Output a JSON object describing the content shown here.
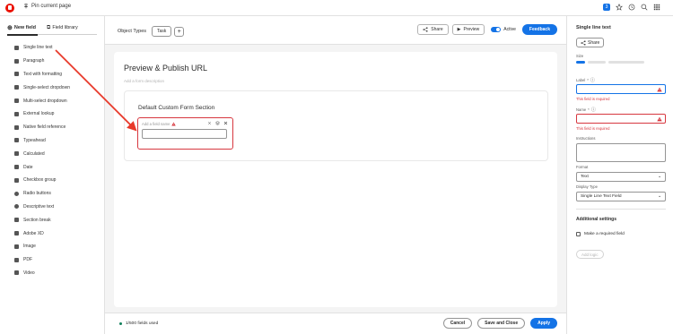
{
  "topbar": {
    "pin_label": "Pin current page",
    "badge_count": "3",
    "icons": [
      "star-icon",
      "history-icon",
      "search-icon",
      "apps-grid-icon"
    ]
  },
  "sidebar": {
    "tabs": [
      {
        "label": "New field",
        "icon": "plus-icon",
        "active": true
      },
      {
        "label": "Field library",
        "icon": "library-icon",
        "active": false
      }
    ],
    "items": [
      {
        "label": "Single line text",
        "icon": "text-icon"
      },
      {
        "label": "Paragraph",
        "icon": "paragraph-icon"
      },
      {
        "label": "Text with formatting",
        "icon": "format-icon"
      },
      {
        "label": "Single-select dropdown",
        "icon": "dropdown-icon"
      },
      {
        "label": "Multi-select dropdown",
        "icon": "multi-dropdown-icon"
      },
      {
        "label": "External lookup",
        "icon": "lookup-icon"
      },
      {
        "label": "Native field reference",
        "icon": "reference-icon"
      },
      {
        "label": "Typeahead",
        "icon": "typeahead-icon"
      },
      {
        "label": "Calculated",
        "icon": "calculator-icon"
      },
      {
        "label": "Date",
        "icon": "calendar-icon"
      },
      {
        "label": "Checkbox group",
        "icon": "checkbox-icon"
      },
      {
        "label": "Radio buttons",
        "icon": "radio-icon"
      },
      {
        "label": "Descriptive text",
        "icon": "info-icon"
      },
      {
        "label": "Section break",
        "icon": "section-icon"
      },
      {
        "label": "Adobe XD",
        "icon": "xd-icon"
      },
      {
        "label": "Image",
        "icon": "image-icon"
      },
      {
        "label": "PDF",
        "icon": "pdf-icon"
      },
      {
        "label": "Video",
        "icon": "video-icon"
      }
    ]
  },
  "toolbar": {
    "object_types_label": "Object Types",
    "object_type_chip": "Task",
    "add_label": "+",
    "share_label": "Share",
    "preview_label": "Preview",
    "active_label": "Active",
    "feedback_label": "Feedback"
  },
  "form": {
    "title": "Preview & Publish URL",
    "description_placeholder": "Add a form description",
    "section_title": "Default Custom Form Section",
    "field_name_placeholder": "Add a field name"
  },
  "footer": {
    "usage": "1/500 fields used",
    "cancel_label": "Cancel",
    "save_close_label": "Save and Close",
    "apply_label": "Apply"
  },
  "panel": {
    "title": "Single line text",
    "share_label": "Share",
    "size_label": "Size",
    "label_label": "Label",
    "label_error": "This field is required",
    "name_label": "Name",
    "name_error": "This field is required",
    "instructions_label": "Instructions",
    "format_label": "Format",
    "format_value": "Text",
    "display_type_label": "Display Type",
    "display_type_value": "Single Line Text Field",
    "additional_label": "Additional settings",
    "required_label": "Make a required field",
    "add_logic_label": "Add logic"
  },
  "colors": {
    "accent": "#1473e6",
    "error": "#d7373f",
    "brand": "#eb1000",
    "annotation": "#e8392a"
  }
}
